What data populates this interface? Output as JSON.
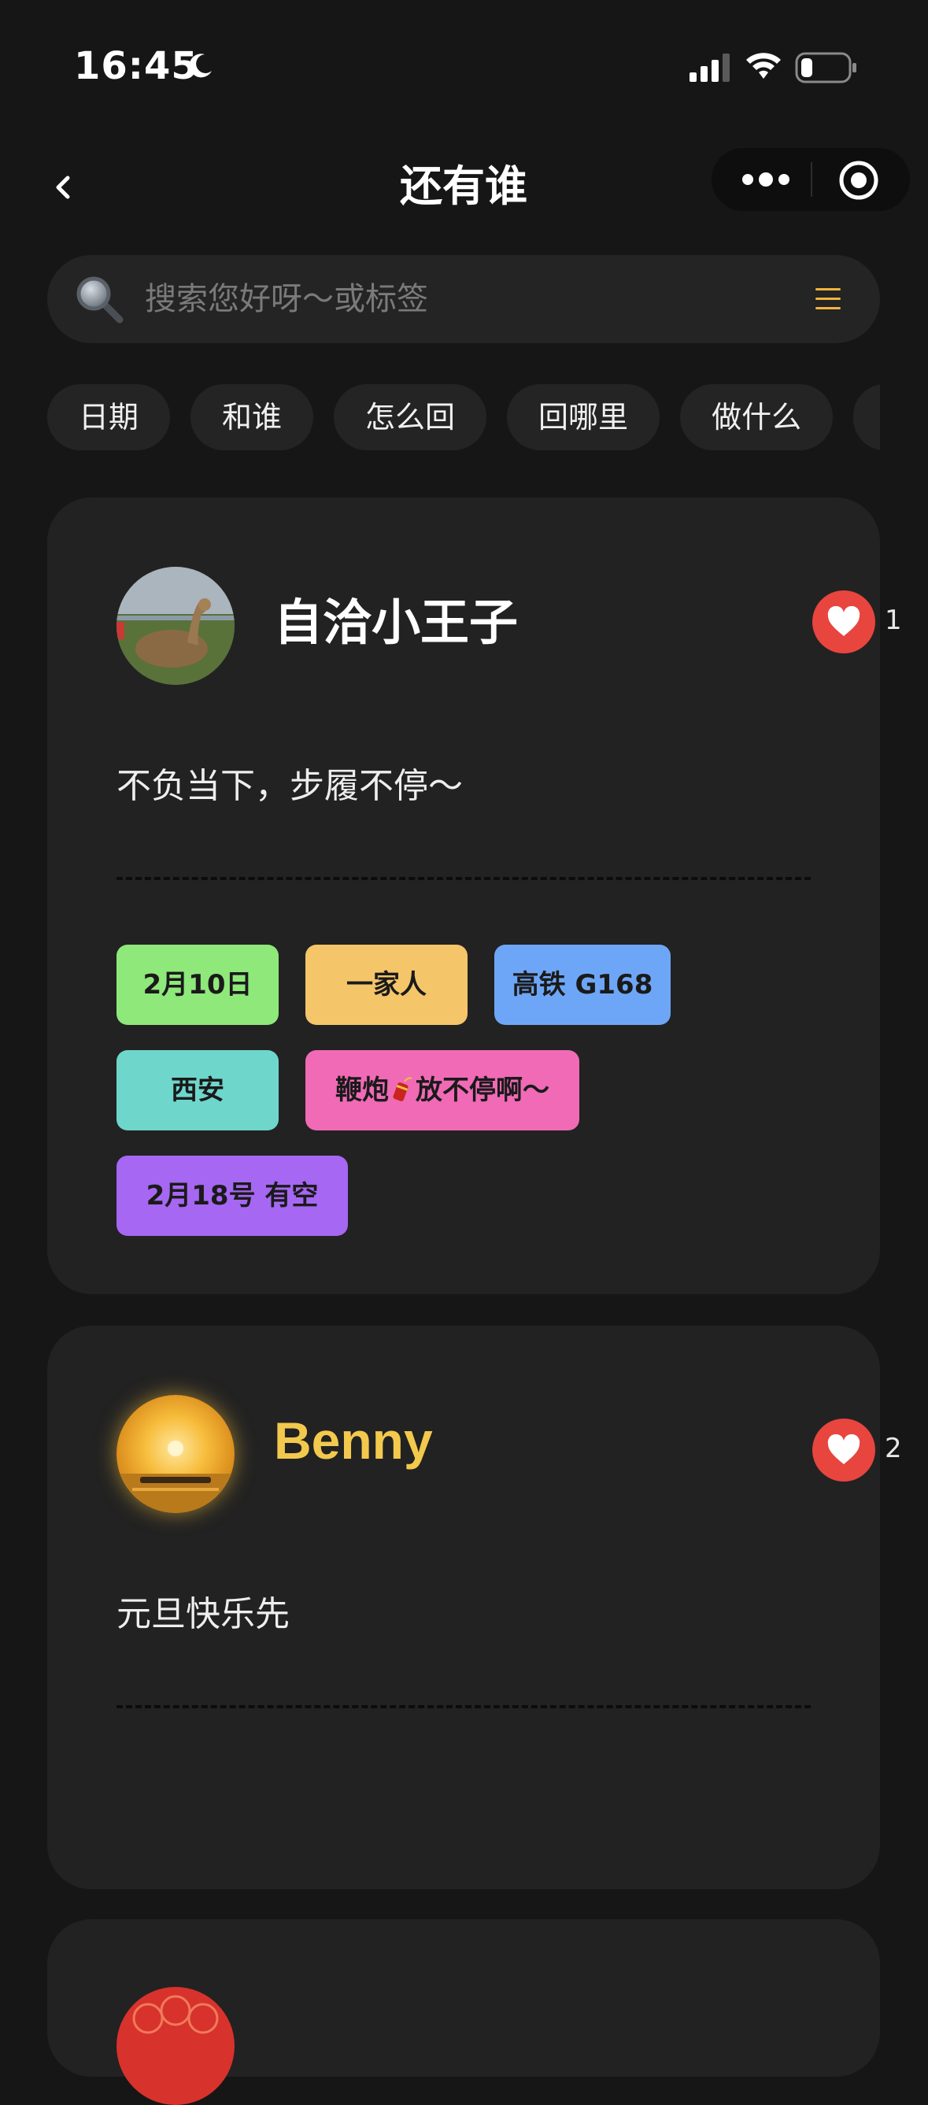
{
  "status_bar": {
    "time": "16:45"
  },
  "nav": {
    "title": "还有谁"
  },
  "search": {
    "placeholder": "搜索您好呀～或标签"
  },
  "categories": [
    "日期",
    "和谁",
    "怎么回",
    "回哪里",
    "做什么"
  ],
  "posts": [
    {
      "name": "自洽小王子",
      "likes": "1",
      "bio": "不负当下，步履不停～",
      "tags": [
        {
          "text": "2月10日",
          "color": "#8ee87a"
        },
        {
          "text": "一家人",
          "color": "#f5c56a"
        },
        {
          "text": "高铁 G168",
          "color": "#6ea6f7"
        },
        {
          "text": "西安",
          "color": "#6fd6cc"
        },
        {
          "text_before": "鞭炮",
          "text_after": "放不停啊～",
          "icon": "firecracker-icon",
          "color": "#f06ab6"
        },
        {
          "text": "2月18号 有空",
          "color": "#a667f2"
        }
      ]
    },
    {
      "name": "Benny",
      "name_color": "#f3c94d",
      "likes": "2",
      "bio": "元旦快乐先"
    }
  ],
  "colors": {
    "background": "#161616",
    "card": "#222222",
    "like": "#e8453f",
    "accent": "#f3c94d"
  }
}
